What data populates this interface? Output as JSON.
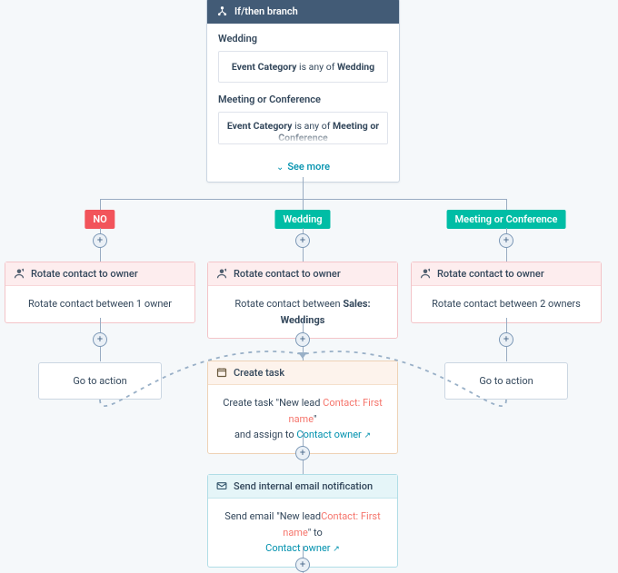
{
  "ifthen": {
    "title": "If/then branch",
    "branch1": {
      "label": "Wedding",
      "filter_prefix": "Event Category",
      "filter_mid": " is any of ",
      "filter_val": "Wedding"
    },
    "branch2": {
      "label": "Meeting or Conference",
      "filter_prefix": "Event Category",
      "filter_mid": " is any of ",
      "filter_val": "Meeting or Conference"
    },
    "see_more": "See more"
  },
  "badges": {
    "no": "NO",
    "wedding": "Wedding",
    "meeting": "Meeting or Conference"
  },
  "rotate": {
    "title": "Rotate contact to owner",
    "left_body": "Rotate contact between 1 owner",
    "mid_prefix": "Rotate contact between ",
    "mid_bold": "Sales: Weddings",
    "right_body": "Rotate contact between 2 owners"
  },
  "goto": {
    "label": "Go to action"
  },
  "create_task": {
    "title": "Create task",
    "line_a": "Create task \"New lead ",
    "token": "Contact: First name",
    "line_b": "\"",
    "line_c": "and assign to ",
    "owner": "Contact owner"
  },
  "email": {
    "title": "Send internal email notification",
    "line_a": "Send email \"New lead",
    "token": "Contact: First name",
    "line_b": "\" to",
    "owner": "Contact owner"
  }
}
